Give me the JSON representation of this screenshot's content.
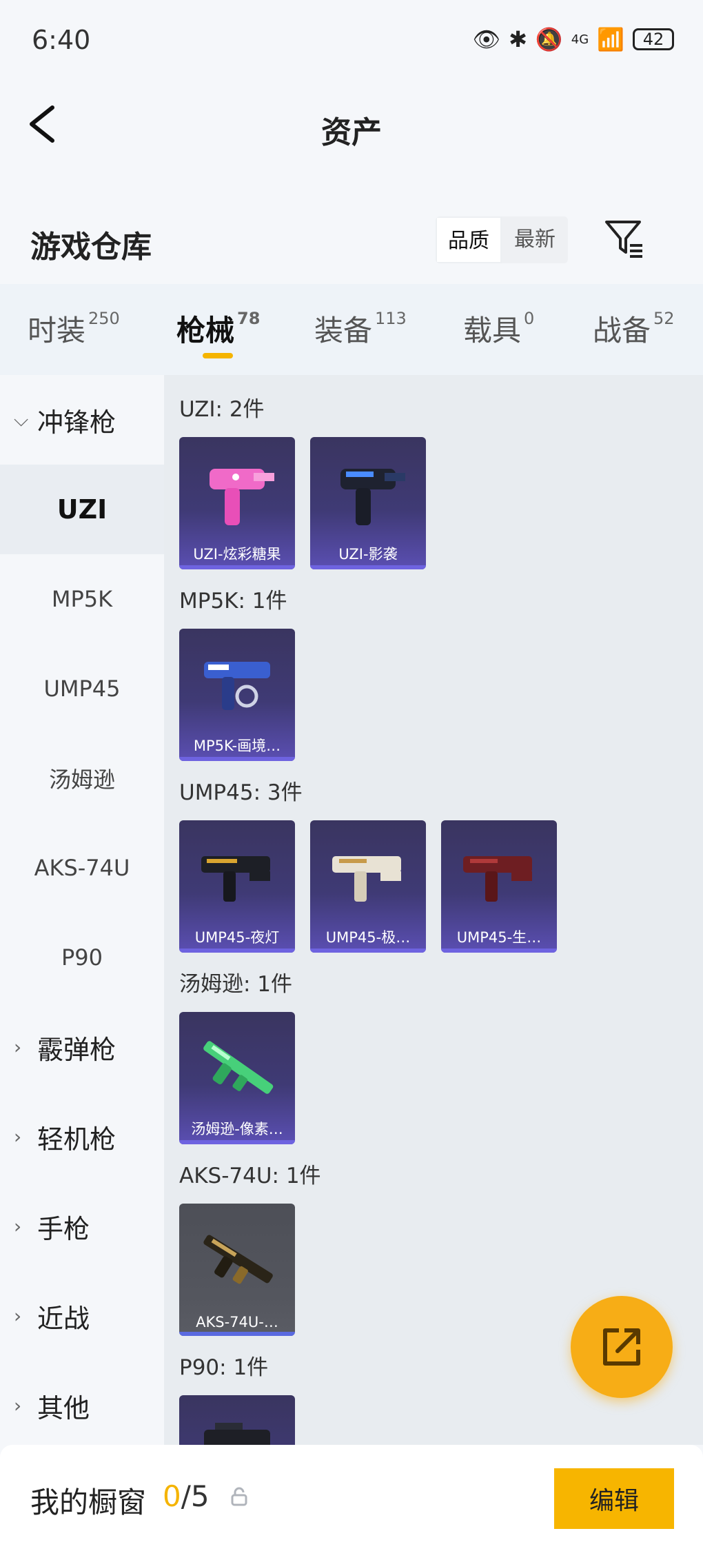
{
  "status_bar": {
    "time": "6:40",
    "battery": "42",
    "network": "4G"
  },
  "header": {
    "title": "资产"
  },
  "section": {
    "title": "游戏仓库",
    "sort_options": [
      "品质",
      "最新"
    ]
  },
  "tabs": [
    {
      "label": "时装",
      "count": "250"
    },
    {
      "label": "枪械",
      "count": "78"
    },
    {
      "label": "装备",
      "count": "113"
    },
    {
      "label": "载具",
      "count": "0"
    },
    {
      "label": "战备",
      "count": "52"
    }
  ],
  "sidebar": [
    {
      "label": "冲锋枪"
    },
    {
      "label": "UZI"
    },
    {
      "label": "MP5K"
    },
    {
      "label": "UMP45"
    },
    {
      "label": "汤姆逊"
    },
    {
      "label": "AKS-74U"
    },
    {
      "label": "P90"
    },
    {
      "label": "霰弹枪"
    },
    {
      "label": "轻机枪"
    },
    {
      "label": "手枪"
    },
    {
      "label": "近战"
    },
    {
      "label": "其他"
    }
  ],
  "groups": [
    {
      "title": "UZI: 2件",
      "items": [
        "UZI-炫彩糖果",
        "UZI-影袭"
      ]
    },
    {
      "title": "MP5K: 1件",
      "items": [
        "MP5K-画境…"
      ]
    },
    {
      "title": "UMP45: 3件",
      "items": [
        "UMP45-夜灯",
        "UMP45-极…",
        "UMP45-生…"
      ]
    },
    {
      "title": "汤姆逊: 1件",
      "items": [
        "汤姆逊-像素…"
      ]
    },
    {
      "title": "AKS-74U: 1件",
      "items": [
        "AKS-74U-…"
      ]
    },
    {
      "title": "P90: 1件",
      "items": [
        ""
      ]
    }
  ],
  "bottom_bar": {
    "label": "我的橱窗",
    "current": "0",
    "total": "/5",
    "edit_label": "编辑"
  },
  "colors": {
    "accent": "#f7b500",
    "card_purple": "#3f3a75",
    "card_gray": "#54565e"
  }
}
